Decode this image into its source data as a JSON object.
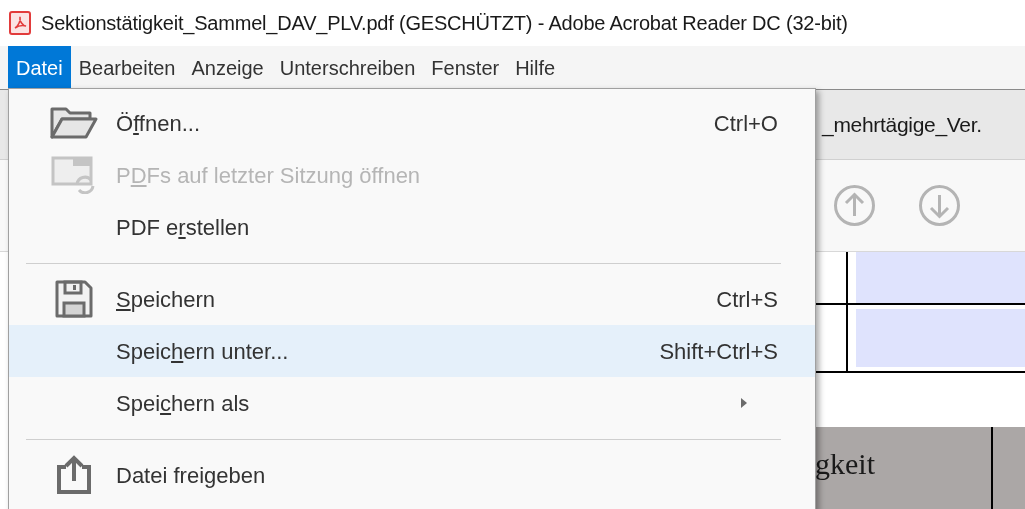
{
  "window": {
    "title": "Sektionstätigkeit_Sammel_DAV_PLV.pdf (GESCHÜTZT) - Adobe Acrobat Reader DC (32-bit)"
  },
  "menu_bar": [
    {
      "label": "Datei",
      "selected": true
    },
    {
      "label": "Bearbeiten",
      "selected": false
    },
    {
      "label": "Anzeige",
      "selected": false
    },
    {
      "label": "Unterschreiben",
      "selected": false
    },
    {
      "label": "Fenster",
      "selected": false
    },
    {
      "label": "Hilfe",
      "selected": false
    }
  ],
  "document_tab": {
    "title": "_mehrtägige_Ver."
  },
  "document": {
    "header_cell": "gkeit"
  },
  "file_menu": {
    "items": [
      {
        "kind": "item",
        "label": [
          {
            "text": "Ö",
            "underlined": false
          },
          {
            "text": "f",
            "underlined": true
          },
          {
            "text": "fnen...",
            "underlined": false
          }
        ],
        "shortcut": "Ctrl+O",
        "disabled": false,
        "selected": false,
        "submenu": false
      },
      {
        "kind": "item",
        "label": [
          {
            "text": "P",
            "underlined": false
          },
          {
            "text": "D",
            "underlined": true
          },
          {
            "text": "Fs auf letzter Sitzung öffnen",
            "underlined": false
          }
        ],
        "disabled": true,
        "selected": false,
        "submenu": false
      },
      {
        "kind": "item",
        "label": [
          {
            "text": "PDF e",
            "underlined": false
          },
          {
            "text": "r",
            "underlined": true
          },
          {
            "text": "stellen",
            "underlined": false
          }
        ],
        "disabled": false,
        "selected": false,
        "submenu": false
      },
      {
        "kind": "separator"
      },
      {
        "kind": "item",
        "label": [
          {
            "text": "S",
            "underlined": true
          },
          {
            "text": "peichern",
            "underlined": false
          }
        ],
        "shortcut": "Ctrl+S",
        "disabled": false,
        "selected": false,
        "submenu": false
      },
      {
        "kind": "item",
        "label": [
          {
            "text": "Speic",
            "underlined": false
          },
          {
            "text": "h",
            "underlined": true
          },
          {
            "text": "ern unter...",
            "underlined": false
          }
        ],
        "shortcut": "Shift+Ctrl+S",
        "disabled": false,
        "selected": true,
        "submenu": false
      },
      {
        "kind": "item",
        "label": [
          {
            "text": "Spei",
            "underlined": false
          },
          {
            "text": "c",
            "underlined": true
          },
          {
            "text": "hern als",
            "underlined": false
          }
        ],
        "disabled": false,
        "selected": false,
        "submenu": true
      },
      {
        "kind": "separator"
      },
      {
        "kind": "item",
        "label": [
          {
            "text": "Datei freigeben",
            "underlined": false
          }
        ],
        "disabled": false,
        "selected": false,
        "submenu": false
      }
    ]
  }
}
